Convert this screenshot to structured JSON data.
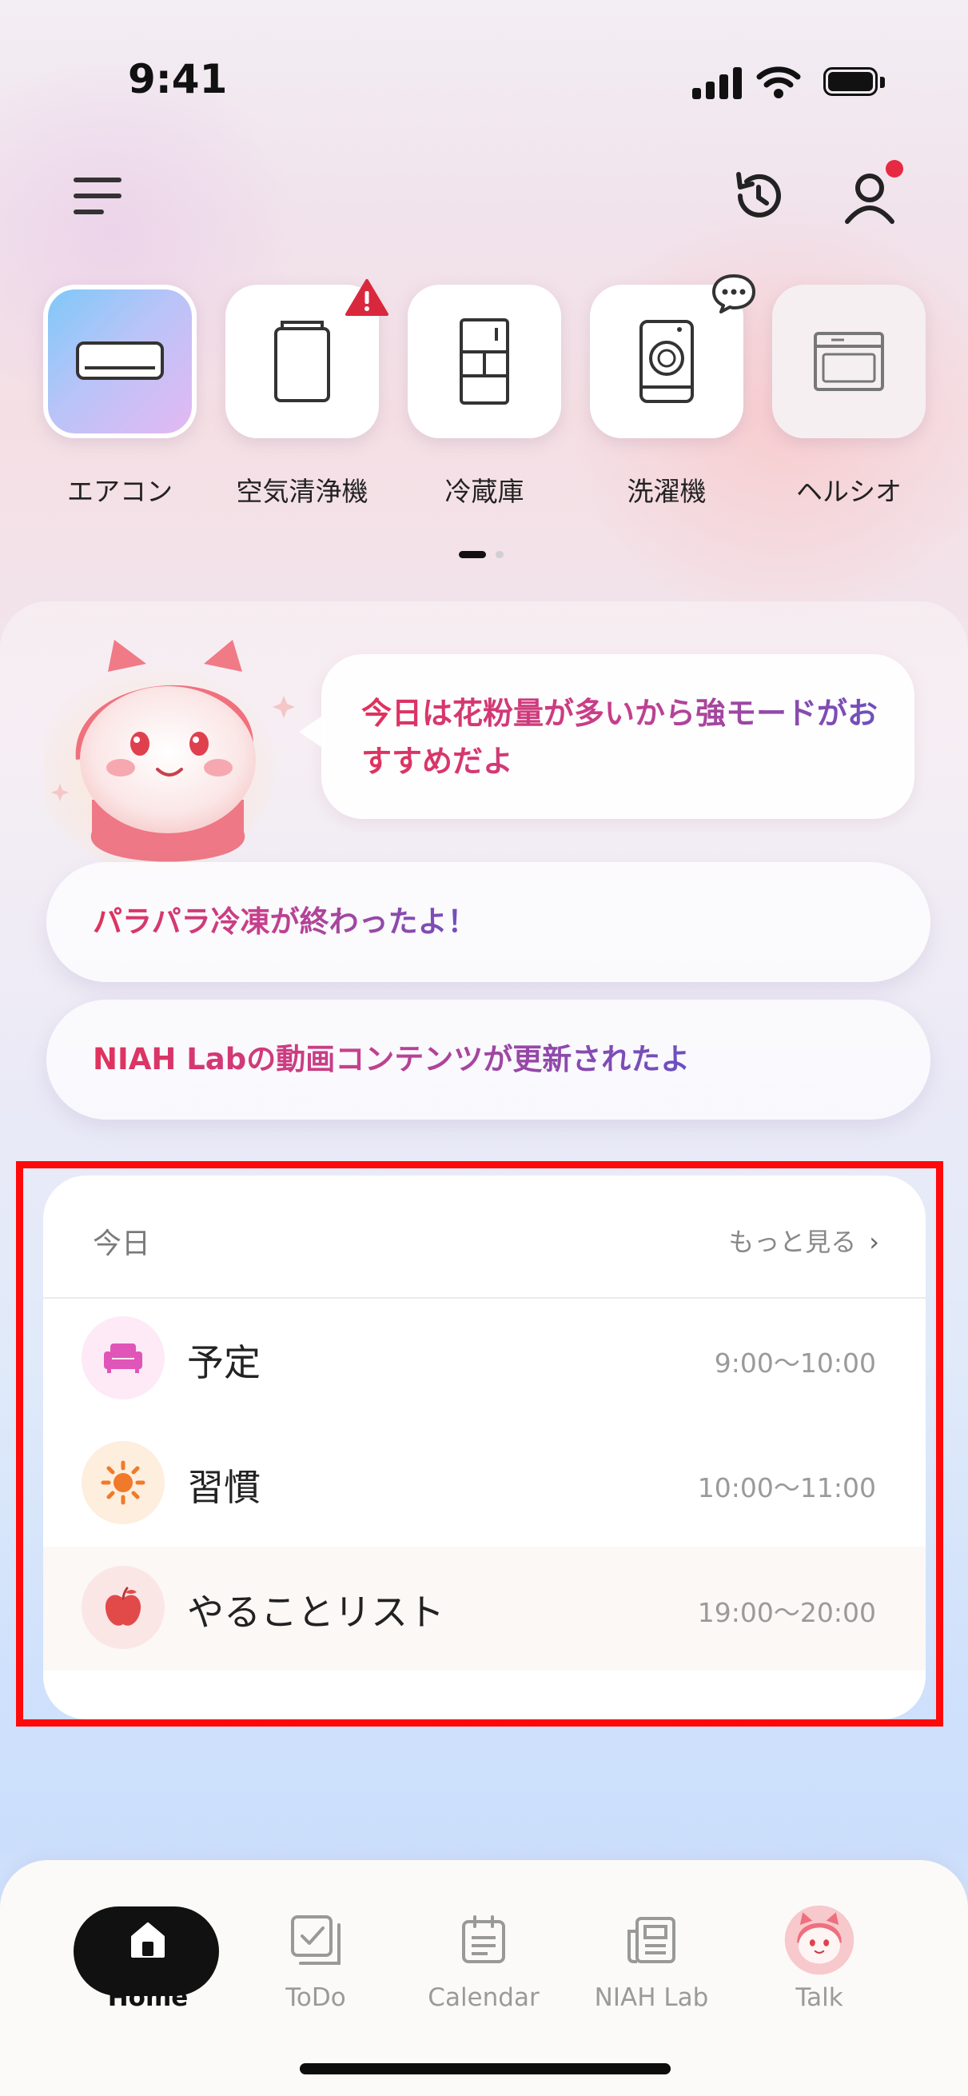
{
  "status_bar": {
    "time": "9:41"
  },
  "devices": [
    {
      "label": "エアコン",
      "icon": "air-conditioner-icon",
      "state": "selected"
    },
    {
      "label": "空気清浄機",
      "icon": "air-purifier-icon",
      "badge": "warning"
    },
    {
      "label": "冷蔵庫",
      "icon": "refrigerator-icon"
    },
    {
      "label": "洗濯機",
      "icon": "washing-machine-icon",
      "badge": "message"
    },
    {
      "label": "ヘルシオ",
      "icon": "oven-icon"
    }
  ],
  "assistant": {
    "message": "今日は花粉量が多いから強モードがおすすめだよ"
  },
  "notifications": [
    "パラパラ冷凍が終わったよ！",
    "NIAH Labの動画コンテンツが更新されたよ"
  ],
  "today": {
    "title": "今日",
    "more_label": "もっと見る",
    "items": [
      {
        "name": "予定",
        "time": "9:00～10:00",
        "icon": "sofa-icon",
        "color": "#e055b8"
      },
      {
        "name": "習慣",
        "time": "10:00～11:00",
        "icon": "sun-icon",
        "color": "#f07a2a"
      },
      {
        "name": "やることリスト",
        "time": "19:00～20:00",
        "icon": "apple-icon",
        "color": "#e24a4a"
      }
    ]
  },
  "nav": [
    {
      "label": "Home",
      "icon": "home-icon",
      "active": true
    },
    {
      "label": "ToDo",
      "icon": "todo-icon"
    },
    {
      "label": "Calendar",
      "icon": "calendar-icon"
    },
    {
      "label": "NIAH Lab",
      "icon": "news-icon"
    },
    {
      "label": "Talk",
      "icon": "mascot-avatar-icon"
    }
  ],
  "colors": {
    "accent_pink": "#e0325c",
    "accent_purple": "#6a50c0",
    "highlight_border": "#ff0a0a",
    "notification_dot": "#e62a42"
  }
}
